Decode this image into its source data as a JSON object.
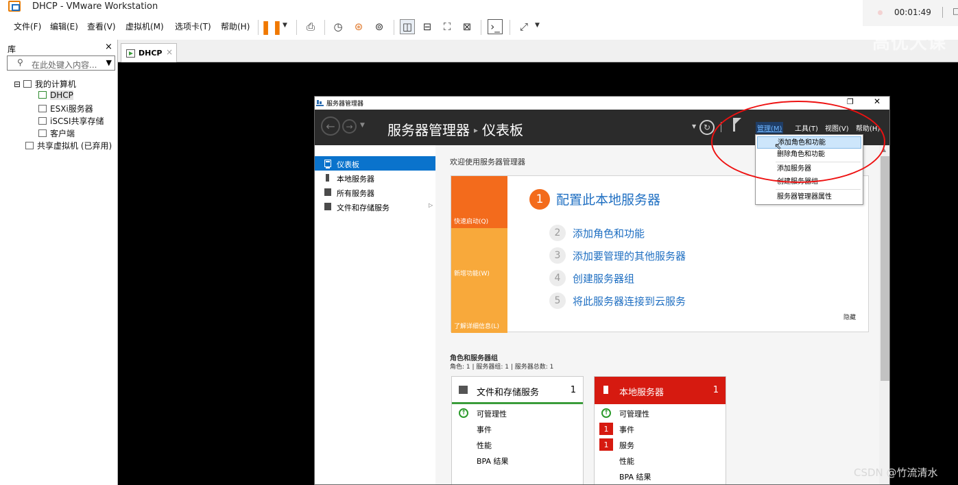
{
  "window": {
    "title": "DHCP - VMware Workstation"
  },
  "menu": [
    "文件(F)",
    "编辑(E)",
    "查看(V)",
    "虚拟机(M)",
    "选项卡(T)",
    "帮助(H)"
  ],
  "toolbar_icons": [
    "pause-icon",
    "send-keys-icon",
    "snapshot-icon",
    "revert-snapshot-icon",
    "snapshot-manager-icon",
    "view-library-icon",
    "view-thumbnail-icon",
    "fullscreen-icon",
    "unity-icon",
    "console-icon",
    "stretch-icon"
  ],
  "recorder": {
    "time": "00:01:49"
  },
  "watermark": "高优大课",
  "library": {
    "title": "库",
    "close": "×",
    "search_placeholder": "在此处键入内容...",
    "tree": [
      {
        "label": "我的计算机",
        "toggle": "⊟"
      },
      {
        "label": "DHCP",
        "selected": true
      },
      {
        "label": "ESXi服务器"
      },
      {
        "label": "iSCSI共享存储"
      },
      {
        "label": "客户端"
      },
      {
        "label": "共享虚拟机 (已弃用)"
      }
    ]
  },
  "tab": {
    "label": "DHCP",
    "close": "×"
  },
  "server_manager": {
    "title": "服务器管理器",
    "breadcrumb_root": "服务器管理器",
    "breadcrumb_sep": "▸",
    "breadcrumb_page": "仪表板",
    "menus": [
      "管理(M)",
      "工具(T)",
      "视图(V)",
      "帮助(H)"
    ],
    "sidebar": [
      "仪表板",
      "本地服务器",
      "所有服务器",
      "文件和存储服务"
    ],
    "welcome_title": "欢迎使用服务器管理器",
    "quick_start": [
      "快速启动(Q)",
      "新增功能(W)",
      "了解详细信息(L)"
    ],
    "steps": [
      {
        "num": "1",
        "label": "配置此本地服务器"
      },
      {
        "num": "2",
        "label": "添加角色和功能"
      },
      {
        "num": "3",
        "label": "添加要管理的其他服务器"
      },
      {
        "num": "4",
        "label": "创建服务器组"
      },
      {
        "num": "5",
        "label": "将此服务器连接到云服务"
      }
    ],
    "hide": "隐藏",
    "roles_title": "角色和服务器组",
    "roles_summary": "角色: 1 | 服务器组: 1 | 服务器总数: 1",
    "tiles": [
      {
        "name": "文件和存储服务",
        "count": "1",
        "rows": [
          {
            "label": "可管理性",
            "status": "ok"
          },
          {
            "label": "事件"
          },
          {
            "label": "性能"
          },
          {
            "label": "BPA 结果"
          }
        ]
      },
      {
        "name": "本地服务器",
        "count": "1",
        "rows": [
          {
            "label": "可管理性",
            "status": "ok"
          },
          {
            "label": "事件",
            "badge": "1"
          },
          {
            "label": "服务",
            "badge": "1"
          },
          {
            "label": "性能"
          },
          {
            "label": "BPA 结果"
          }
        ]
      }
    ],
    "manage_menu": [
      "添加角色和功能",
      "删除角色和功能",
      "添加服务器",
      "创建服务器组",
      "服务器管理器属性"
    ]
  },
  "colors": {
    "accent_blue": "#0a73cc",
    "quick_start_orange": "#f36b1c",
    "quick_start_light": "#f8a93b",
    "alert_red": "#d61a10",
    "annotation_red": "#ee1111"
  },
  "credit": "CSDN @竹流清水"
}
